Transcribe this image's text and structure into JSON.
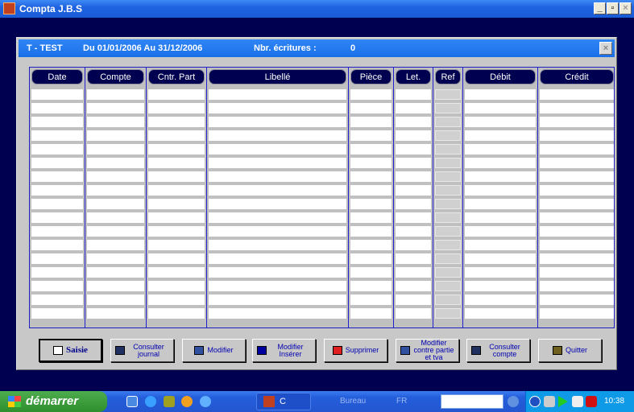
{
  "window": {
    "title": "Compta J.B.S",
    "min": "_",
    "max": "▫",
    "close": "×"
  },
  "dialog": {
    "journal": "T - TEST",
    "period": "Du  01/01/2006  Au  31/12/2006",
    "count_label": "Nbr. écritures :",
    "count": "0",
    "close": "×"
  },
  "columns": [
    "Date",
    "Compte",
    "Cntr. Part",
    "Libellé",
    "Pièce",
    "Let.",
    "Ref",
    "Débit",
    "Crédit"
  ],
  "buttons": [
    {
      "label": "Saisie",
      "icon": "document-icon"
    },
    {
      "label": "Consulter journal",
      "icon": "binoculars-icon"
    },
    {
      "label": "Modifier",
      "icon": "edit-icon"
    },
    {
      "label": "Modifier Insérer",
      "icon": "play-icon"
    },
    {
      "label": "Supprimer",
      "icon": "delete-icon"
    },
    {
      "label": "Modifier contre partie et tva",
      "icon": "edit-icon"
    },
    {
      "label": "Consulter compte",
      "icon": "binoculars-icon"
    },
    {
      "label": "Quitter",
      "icon": "exit-icon"
    }
  ],
  "taskbar": {
    "start": "démarrer",
    "task": "C",
    "toolbar": "Bureau",
    "lang": "FR",
    "clock": "10:38"
  }
}
